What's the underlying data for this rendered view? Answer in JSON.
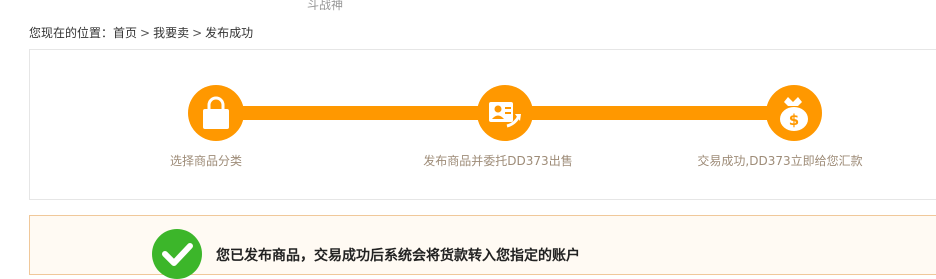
{
  "header": {
    "game_name": "斗战神"
  },
  "breadcrumb": {
    "prefix": "您现在的位置：",
    "items": [
      "首页",
      "我要卖",
      "发布成功"
    ],
    "separator": ">"
  },
  "steps": [
    {
      "label": "选择商品分类",
      "icon": "shopping-bag-icon"
    },
    {
      "label": "发布商品并委托DD373出售",
      "icon": "publish-card-icon"
    },
    {
      "label": "交易成功,DD373立即给您汇款",
      "icon": "money-bag-icon"
    }
  ],
  "success": {
    "message": "您已发布商品，交易成功后系统会将货款转入您指定的账户",
    "icon": "checkmark-icon"
  },
  "colors": {
    "accent": "#ff9800",
    "success": "#3cb62a",
    "step_label": "#9e8c78"
  }
}
